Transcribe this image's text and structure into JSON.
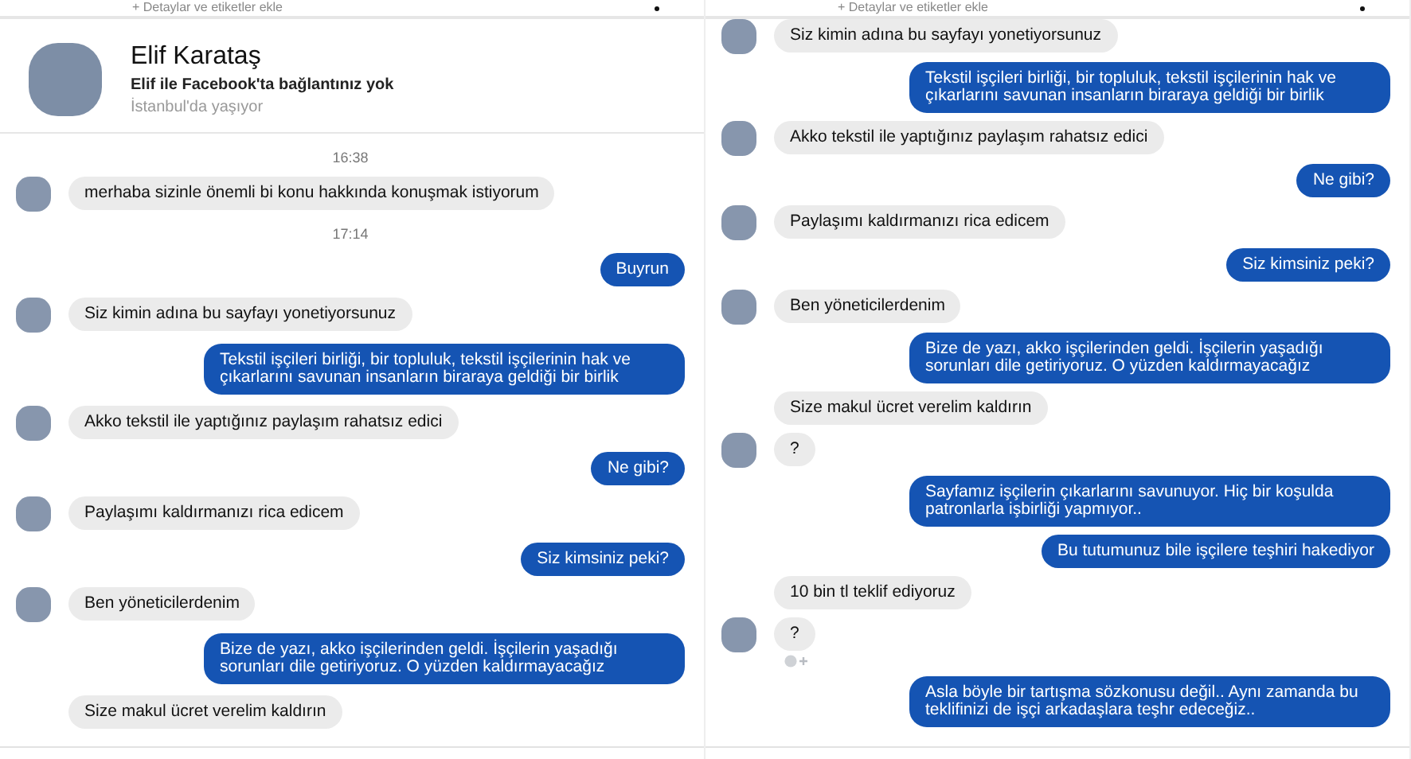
{
  "panels": [
    {
      "header": {
        "subtitle": "+ Detaylar ve etiketler ekle"
      },
      "profile": {
        "name": "Elif Karataş",
        "connection": "Elif ile Facebook'ta bağlantınız yok",
        "location": "İstanbul'da yaşıyor"
      },
      "messages": [
        {
          "kind": "time",
          "text": "16:38"
        },
        {
          "kind": "incoming",
          "avatar": true,
          "text": "merhaba sizinle önemli bi konu hakkında konuşmak istiyorum"
        },
        {
          "kind": "time",
          "text": "17:14"
        },
        {
          "kind": "outgoing",
          "text": "Buyrun"
        },
        {
          "kind": "incoming",
          "avatar": true,
          "text": "Siz kimin adına bu sayfayı yonetiyorsunuz"
        },
        {
          "kind": "outgoing",
          "text": "Tekstil işçileri birliği, bir topluluk, tekstil işçilerinin hak ve çıkarlarını savunan insanların biraraya geldiği bir birlik"
        },
        {
          "kind": "incoming",
          "avatar": true,
          "text": "Akko tekstil ile yaptığınız paylaşım rahatsız edici"
        },
        {
          "kind": "outgoing",
          "text": "Ne gibi?"
        },
        {
          "kind": "incoming",
          "avatar": true,
          "text": "Paylaşımı kaldırmanızı rica edicem"
        },
        {
          "kind": "outgoing",
          "text": "Siz kimsiniz peki?"
        },
        {
          "kind": "incoming",
          "avatar": true,
          "text": "Ben yöneticilerdenim"
        },
        {
          "kind": "outgoing",
          "text": "Bize de yazı, akko işçilerinden geldi. İşçilerin yaşadığı sorunları dile getiriyoruz. O yüzden kaldırmayacağız"
        },
        {
          "kind": "incoming",
          "avatar": false,
          "text": "Size makul ücret verelim kaldırın"
        }
      ]
    },
    {
      "header": {
        "subtitle": "+ Detaylar ve etiketler ekle"
      },
      "messages": [
        {
          "kind": "incoming",
          "avatar": true,
          "text": "Siz kimin adına bu sayfayı yonetiyorsunuz"
        },
        {
          "kind": "outgoing",
          "text": "Tekstil işçileri birliği, bir topluluk, tekstil işçilerinin hak ve çıkarlarını savunan insanların biraraya geldiği bir birlik"
        },
        {
          "kind": "incoming",
          "avatar": true,
          "text": "Akko tekstil ile yaptığınız paylaşım rahatsız edici"
        },
        {
          "kind": "outgoing",
          "text": "Ne gibi?"
        },
        {
          "kind": "incoming",
          "avatar": true,
          "text": "Paylaşımı kaldırmanızı rica edicem"
        },
        {
          "kind": "outgoing",
          "text": "Siz kimsiniz peki?"
        },
        {
          "kind": "incoming",
          "avatar": true,
          "text": "Ben yöneticilerdenim"
        },
        {
          "kind": "outgoing",
          "text": "Bize de yazı, akko işçilerinden geldi. İşçilerin yaşadığı sorunları dile getiriyoruz. O yüzden kaldırmayacağız"
        },
        {
          "kind": "incoming",
          "avatar": false,
          "text": "Size makul ücret verelim kaldırın"
        },
        {
          "kind": "incoming",
          "avatar": true,
          "text": "?"
        },
        {
          "kind": "outgoing",
          "text": "Sayfamız işçilerin çıkarlarını savunuyor. Hiç bir koşulda patronlarla işbirliği yapmıyor.."
        },
        {
          "kind": "outgoing",
          "text": "Bu tutumunuz bile işçilere teşhiri hakediyor"
        },
        {
          "kind": "incoming",
          "avatar": false,
          "text": "10 bin tl teklif ediyoruz"
        },
        {
          "kind": "incoming",
          "avatar": true,
          "reaction": true,
          "text": "?"
        },
        {
          "kind": "outgoing",
          "text": "Asla böyle bir tartışma sözkonusu değil.. Aynı zamanda bu teklifinizi de işçi arkadaşlara teşhr edeceğiz.."
        }
      ]
    }
  ]
}
